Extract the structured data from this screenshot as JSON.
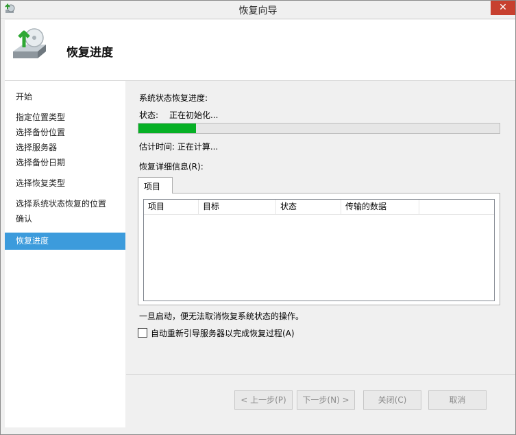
{
  "window": {
    "title": "恢复向导",
    "close_glyph": "✕"
  },
  "header": {
    "title": "恢复进度",
    "icon": "restore-drive-icon"
  },
  "sidebar": {
    "items": [
      {
        "label": "开始"
      },
      {
        "label": "指定位置类型"
      },
      {
        "label": "选择备份位置"
      },
      {
        "label": "选择服务器"
      },
      {
        "label": "选择备份日期"
      },
      {
        "label": "选择恢复类型"
      },
      {
        "label": "选择系统状态恢复的位置"
      },
      {
        "label": "确认"
      },
      {
        "label": "恢复进度"
      }
    ],
    "active_index": 8
  },
  "main": {
    "progress_heading": "系统状态恢复进度:",
    "status_label": "状态:",
    "status_value": "正在初始化...",
    "progress_fraction": 0.16,
    "progress_color": "#06b025",
    "eta_text": "估计时间: 正在计算...",
    "details_label": "恢复详细信息(R):",
    "tab_label": "项目",
    "columns": [
      "项目",
      "目标",
      "状态",
      "传输的数据"
    ],
    "warning_text": "一旦启动，便无法取消恢复系统状态的操作。",
    "checkbox_label": "自动重新引导服务器以完成恢复过程(A)",
    "checkbox_checked": false
  },
  "buttons": {
    "back": "< 上一步(P)",
    "next": "下一步(N) >",
    "close": "关闭(C)",
    "cancel": "取消"
  }
}
